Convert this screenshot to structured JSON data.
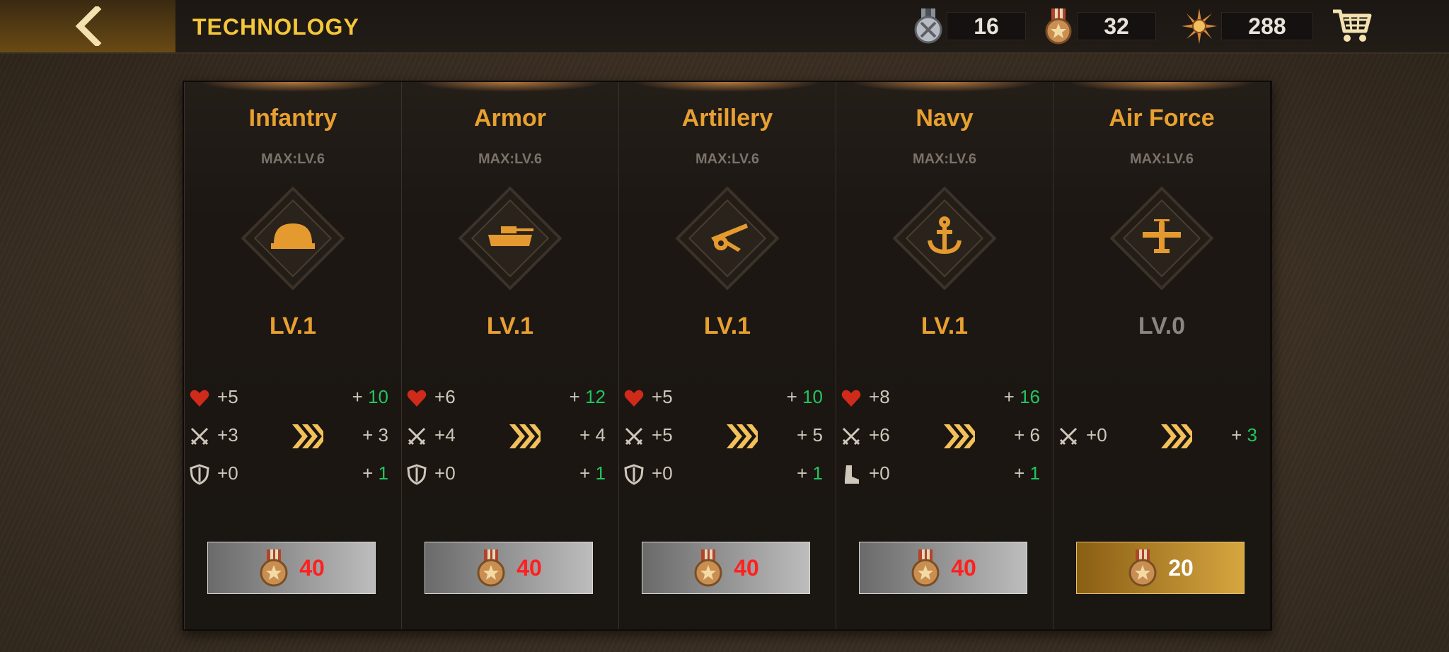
{
  "header": {
    "title": "TECHNOLOGY",
    "currencies": [
      {
        "name": "silver-medal",
        "value": "16"
      },
      {
        "name": "bronze-medal",
        "value": "32"
      },
      {
        "name": "sunburst-medal",
        "value": "288"
      }
    ]
  },
  "panels": [
    {
      "name": "Infantry",
      "max": "MAX:LV.6",
      "level": "LV.1",
      "level_color": "#e8a030",
      "icon": "helmet",
      "stats": [
        {
          "icon": "heart",
          "cur": "5",
          "next": "10",
          "next_color": "#22c55e"
        },
        {
          "icon": "swords",
          "cur": "3",
          "next": "3",
          "next_color": "#cfc7bb"
        },
        {
          "icon": "shield",
          "cur": "0",
          "next": "1",
          "next_color": "#22c55e"
        }
      ],
      "cost": "40",
      "cost_color": "#ff2020",
      "button_style": "gray"
    },
    {
      "name": "Armor",
      "max": "MAX:LV.6",
      "level": "LV.1",
      "level_color": "#e8a030",
      "icon": "tank",
      "stats": [
        {
          "icon": "heart",
          "cur": "6",
          "next": "12",
          "next_color": "#22c55e"
        },
        {
          "icon": "swords",
          "cur": "4",
          "next": "4",
          "next_color": "#cfc7bb"
        },
        {
          "icon": "shield",
          "cur": "0",
          "next": "1",
          "next_color": "#22c55e"
        }
      ],
      "cost": "40",
      "cost_color": "#ff2020",
      "button_style": "gray"
    },
    {
      "name": "Artillery",
      "max": "MAX:LV.6",
      "level": "LV.1",
      "level_color": "#e8a030",
      "icon": "cannon",
      "stats": [
        {
          "icon": "heart",
          "cur": "5",
          "next": "10",
          "next_color": "#22c55e"
        },
        {
          "icon": "swords",
          "cur": "5",
          "next": "5",
          "next_color": "#cfc7bb"
        },
        {
          "icon": "shield",
          "cur": "0",
          "next": "1",
          "next_color": "#22c55e"
        }
      ],
      "cost": "40",
      "cost_color": "#ff2020",
      "button_style": "gray"
    },
    {
      "name": "Navy",
      "max": "MAX:LV.6",
      "level": "LV.1",
      "level_color": "#e8a030",
      "icon": "anchor",
      "stats": [
        {
          "icon": "heart",
          "cur": "8",
          "next": "16",
          "next_color": "#22c55e"
        },
        {
          "icon": "swords",
          "cur": "6",
          "next": "6",
          "next_color": "#cfc7bb"
        },
        {
          "icon": "boot",
          "cur": "0",
          "next": "1",
          "next_color": "#22c55e"
        }
      ],
      "cost": "40",
      "cost_color": "#ff2020",
      "button_style": "gray"
    },
    {
      "name": "Air Force",
      "max": "MAX:LV.6",
      "level": "LV.0",
      "level_color": "#8a8580",
      "icon": "plane",
      "stats": [
        {
          "icon": "swords",
          "cur": "0",
          "next": "3",
          "next_color": "#22c55e"
        }
      ],
      "cost": "20",
      "cost_color": "#ffffff",
      "button_style": "gold"
    }
  ]
}
